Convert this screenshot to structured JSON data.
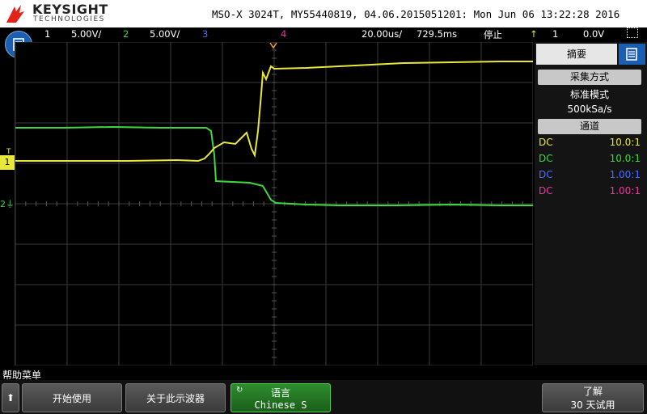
{
  "header": {
    "brand": "KEYSIGHT",
    "brand_sub": "TECHNOLOGIES",
    "title": "MSO-X 3024T, MY55440819, 04.06.2015051201: Mon Jun 06 13:22:28 2016"
  },
  "channel_bar": {
    "ch1": {
      "num": "1",
      "scale": "5.00V/",
      "color": "#e8e83a"
    },
    "ch2": {
      "num": "2",
      "scale": "5.00V/",
      "color": "#3ed83e"
    },
    "ch3": {
      "num": "3",
      "color": "#4a6cff"
    },
    "ch4": {
      "num": "4",
      "color": "#e03c9a"
    },
    "timebase": "20.00us/",
    "delay": "729.5ms",
    "run_state": "停止",
    "trigger_source": "1",
    "trigger_level": "0.0V"
  },
  "markers": {
    "ch1": "1",
    "ch2": "2",
    "trigger_t": "T"
  },
  "right_panel": {
    "tab_summary": "摘要",
    "acq_button": "采集方式",
    "acq_mode": "标准模式",
    "sample_rate": "500kSa/s",
    "channel_button": "通道",
    "channels": [
      {
        "coupling": "DC",
        "probe": "10.0:1",
        "color": "#e8e83a"
      },
      {
        "coupling": "DC",
        "probe": "10.0:1",
        "color": "#3ed83e"
      },
      {
        "coupling": "DC",
        "probe": "1.00:1",
        "color": "#4a6cff"
      },
      {
        "coupling": "DC",
        "probe": "1.00:1",
        "color": "#e03c9a"
      }
    ]
  },
  "softkeys": {
    "help_label": "帮助菜单",
    "getting_started": "开始使用",
    "about": "关于此示波器",
    "language_title": "语言",
    "language_value": "Chinese S",
    "learn_title": "了解",
    "learn_value": "30 天试用"
  },
  "waveforms": {
    "ch1_color": "#e8e83a",
    "ch2_color": "#3ed83e"
  }
}
